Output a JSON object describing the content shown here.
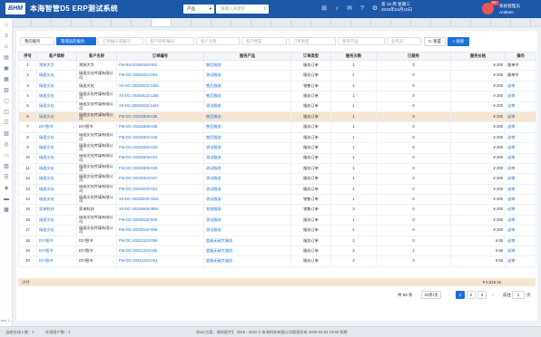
{
  "header": {
    "title": "本海智管D5 ERP测试系统",
    "logo_text": "BHM",
    "product_select": "产品",
    "search_placeholder": "请输入关键字",
    "date_line1": "第 16 周 星期三",
    "date_line2": "2026年04月15日",
    "badge": "99+",
    "user_line1": "系统管理员",
    "user_line2": "Anthem",
    "icons": [
      "notice-icon",
      "bell-icon",
      "mail-icon",
      "help-icon",
      "settings-icon"
    ]
  },
  "tabs": [
    "",
    "",
    "",
    "",
    "",
    "",
    "",
    "",
    "",
    "",
    "",
    "",
    "",
    "",
    "",
    "",
    "",
    "",
    "",
    "",
    "",
    "",
    "",
    "",
    "",
    ""
  ],
  "filters": {
    "mine_label": "我的服务",
    "active_label": "管理员的服务",
    "order_placeholder": "订单编号或编号",
    "customer_name_placeholder": "客户简称/编号",
    "customer_placeholder": "客户名称",
    "customer_level_placeholder": "客户档案",
    "order_type_placeholder": "订单类型",
    "service_product_placeholder": "服务产品",
    "sort_placeholder": "业务员",
    "reset_label": "重置",
    "search_label": "搜索"
  },
  "table": {
    "headers": [
      "序号",
      "客户简称",
      "客户名称",
      "订单编号",
      "服务产品",
      "订单类型",
      "服务天数",
      "已服务",
      "服务价格",
      "操作"
    ],
    "rows": [
      {
        "no": "1",
        "short": "常熟大华",
        "name": "常熟大华",
        "order": "FW-BH-20250426-001",
        "product": "售后服务",
        "type": "服务订单",
        "days": "1",
        "done": "0",
        "price": "¥ 200",
        "op": "跟单中",
        "op_link": false
      },
      {
        "no": "2",
        "short": "瑞昌文化",
        "name": "瑞昌文化传媒有限公司",
        "order": "FW-DC-20250424-001",
        "product": "测试服务",
        "type": "服务订单",
        "days": "1",
        "done": "0",
        "price": "¥ 200",
        "op": "跟单中",
        "op_link": false
      },
      {
        "no": "3",
        "short": "瑞昌文化",
        "name": "瑞昌文化",
        "order": "XS-DC-20250423-1264",
        "product": "售后服务",
        "type": "销售订单",
        "days": "1",
        "done": "0",
        "price": "¥ 200",
        "op": "送审",
        "op_link": true
      },
      {
        "no": "4",
        "short": "瑞昌文化",
        "name": "瑞昌文化传媒有限公司",
        "order": "XS-DC-20250423-1265",
        "product": "售后服务",
        "type": "服务订单",
        "days": "1",
        "done": "0",
        "price": "¥ 200",
        "op": "送审",
        "op_link": true
      },
      {
        "no": "5",
        "short": "瑞昌文化",
        "name": "瑞昌文化传媒有限公司",
        "order": "XS-DC-20250423-1264",
        "product": "测试服务",
        "type": "服务订单",
        "days": "1",
        "done": "0",
        "price": "¥ 200",
        "op": "送审",
        "op_link": true
      },
      {
        "no": "6",
        "short": "瑞昌文化",
        "name": "瑞昌文化传媒有限公司",
        "order": "FW-DC-20230306-036",
        "product": "售后服务",
        "type": "服务订单",
        "days": "1",
        "done": "0",
        "price": "¥ 200",
        "op": "送审",
        "op_link": true
      },
      {
        "no": "7",
        "short": "DIY图书",
        "name": "DIY图书",
        "order": "FW-DC-20230306-035",
        "product": "售后服务",
        "type": "服务订单",
        "days": "1",
        "done": "0",
        "price": "¥ 200",
        "op": "送审",
        "op_link": true
      },
      {
        "no": "8",
        "short": "瑞昌文化",
        "name": "瑞昌文化传媒有限公司",
        "order": "FW-DC-20230302-049",
        "product": "售后服务",
        "type": "服务订单",
        "days": "1",
        "done": "0",
        "price": "¥ 200",
        "op": "送审",
        "op_link": true
      },
      {
        "no": "9",
        "short": "瑞昌文化",
        "name": "瑞昌文化传媒有限公司",
        "order": "FW-DC-20230302-033",
        "product": "测试服务",
        "type": "服务订单",
        "days": "1",
        "done": "0",
        "price": "¥ 200",
        "op": "送审",
        "op_link": true
      },
      {
        "no": "10",
        "short": "瑞昌文化",
        "name": "瑞昌文化传媒有限公司",
        "order": "FW-DC-20230306-031",
        "product": "测试服务",
        "type": "服务订单",
        "days": "1",
        "done": "0",
        "price": "¥ 200",
        "op": "送审",
        "op_link": true
      },
      {
        "no": "11",
        "short": "瑞昌文化",
        "name": "瑞昌文化传媒有限公司",
        "order": "FW-DC-20230306-029",
        "product": "测试服务",
        "type": "服务订单",
        "days": "1",
        "done": "0",
        "price": "¥ 200",
        "op": "送审",
        "op_link": true
      },
      {
        "no": "12",
        "short": "瑞昌文化",
        "name": "瑞昌文化传媒有限公司",
        "order": "FW-DC-20230303-027",
        "product": "测试服务",
        "type": "服务订单",
        "days": "1",
        "done": "0",
        "price": "¥ 200",
        "op": "送审",
        "op_link": true
      },
      {
        "no": "13",
        "short": "瑞昌文化",
        "name": "瑞昌文化传媒有限公司",
        "order": "FW-DC-20230225-021",
        "product": "测试服务",
        "type": "服务订单",
        "days": "1",
        "done": "0",
        "price": "¥ 200",
        "op": "送审",
        "op_link": true
      },
      {
        "no": "14",
        "short": "瑞昌文化",
        "name": "瑞昌文化传媒有限公司",
        "order": "XS-DC-20230220-0252",
        "product": "测试服务",
        "type": "销售订单",
        "days": "1",
        "done": "0",
        "price": "¥ 200",
        "op": "送审",
        "op_link": true
      },
      {
        "no": "15",
        "short": "家来科技",
        "name": "家来科技",
        "order": "XS-DC-20240906-0654",
        "product": "其他服务",
        "type": "销售订单",
        "days": "3",
        "done": "0",
        "price": "¥ 200",
        "op": "送审",
        "op_link": true
      },
      {
        "no": "16",
        "short": "瑞昌文化",
        "name": "瑞昌文化传媒有限公司",
        "order": "FW-DC-20230119-009",
        "product": "测试服务",
        "type": "服务订单",
        "days": "1",
        "done": "0",
        "price": "¥ 200",
        "op": "送审",
        "op_link": true
      },
      {
        "no": "17",
        "short": "瑞昌文化",
        "name": "瑞昌文化传媒有限公司",
        "order": "FW-DC-20230119-006",
        "product": "测试服务",
        "type": "服务订单",
        "days": "1",
        "done": "0",
        "price": "¥ 200",
        "op": "送审",
        "op_link": true
      },
      {
        "no": "18",
        "short": "DIY图书",
        "name": "DIY图书",
        "order": "FW-DC-20241223-056",
        "product": "超级无敌大服务",
        "type": "服务订单",
        "days": "2",
        "done": "0",
        "price": "¥ 65",
        "op": "送审",
        "op_link": true
      },
      {
        "no": "19",
        "short": "DIY图书",
        "name": "DIY图书",
        "order": "FW-DC-20241223-055",
        "product": "超级无敌大服务",
        "type": "服务订单",
        "days": "2",
        "done": "1",
        "price": "¥ 65",
        "op": "送审",
        "op_link": true
      },
      {
        "no": "20",
        "short": "DIY图书",
        "name": "DIY图书",
        "order": "FW-DC-20241223-054",
        "product": "超级无敌大服务",
        "type": "服务订单",
        "days": "2",
        "done": "0",
        "price": "¥ 65",
        "op": "送审",
        "op_link": true
      }
    ],
    "summary_label": "小计",
    "summary_total": "¥ 5,815.15"
  },
  "pager": {
    "total": "共 58 条",
    "page_size": "20条/页",
    "pages": [
      "1",
      "2",
      "3"
    ],
    "current": "1",
    "goto_label": "前往",
    "goto_value": "1",
    "page_unit": "页"
  },
  "footer": {
    "left1": "当前在线人数：1",
    "left2": "在线用户数：1",
    "center": "【ELK方案、瑞尚医疗】 2016 - 2022 © 本海科技有限公司版权所有 2026-04-04 23:59 到期",
    "note": "text: 2..."
  },
  "colors": {
    "brand": "#1d57a8",
    "accent": "#1d6fd8",
    "highlight_row": "#f5e5d3"
  }
}
